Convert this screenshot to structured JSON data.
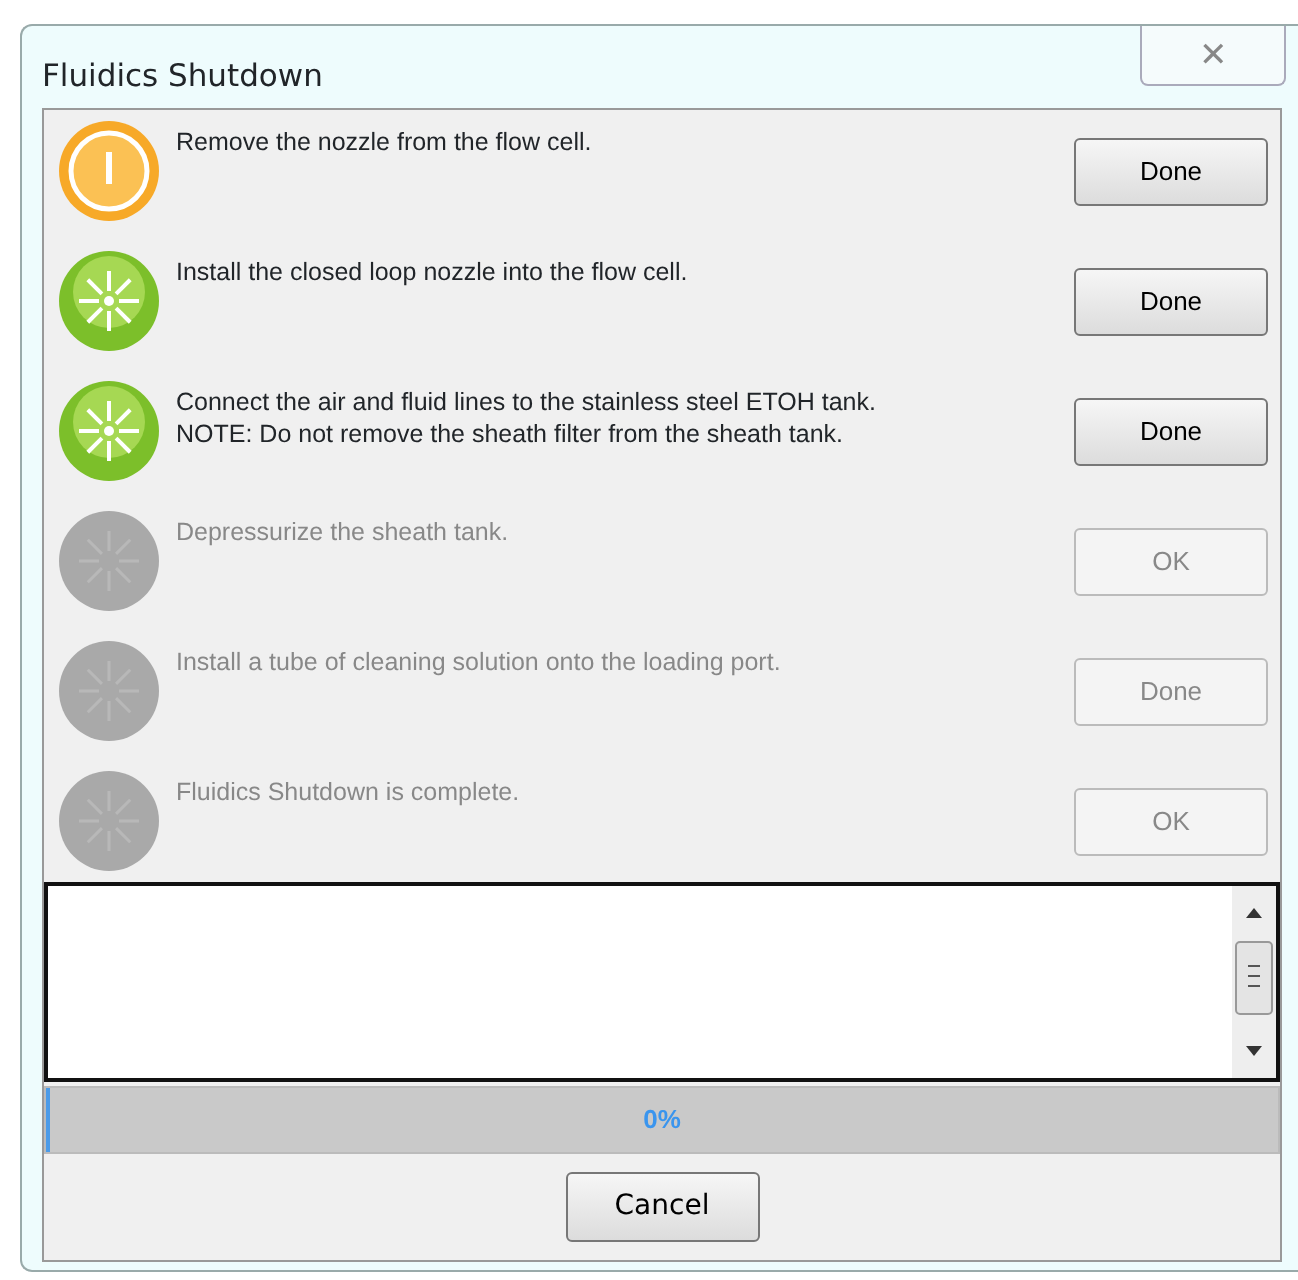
{
  "window": {
    "title": "Fluidics Shutdown",
    "close": "✕"
  },
  "steps": [
    {
      "kind": "current",
      "lines": [
        "Remove the nozzle from the flow cell."
      ],
      "button": {
        "label": "Done",
        "disabled": false
      }
    },
    {
      "kind": "done",
      "lines": [
        "Install the closed loop nozzle into the flow cell."
      ],
      "button": {
        "label": "Done",
        "disabled": false
      }
    },
    {
      "kind": "done",
      "lines": [
        "Connect the air and fluid lines to the stainless steel ETOH tank.",
        "NOTE: Do not remove the sheath filter from the sheath tank."
      ],
      "button": {
        "label": "Done",
        "disabled": false
      }
    },
    {
      "kind": "pending",
      "lines": [
        "Depressurize the sheath tank."
      ],
      "button": {
        "label": "OK",
        "disabled": true
      }
    },
    {
      "kind": "pending",
      "lines": [
        "Install a tube of cleaning solution onto the loading port."
      ],
      "button": {
        "label": "Done",
        "disabled": true
      }
    },
    {
      "kind": "pending",
      "lines": [
        "Fluidics Shutdown is complete."
      ],
      "button": {
        "label": "OK",
        "disabled": true
      }
    }
  ],
  "progress": {
    "level": 0,
    "reading": "0%"
  },
  "buttons": [
    "Cancel"
  ]
}
